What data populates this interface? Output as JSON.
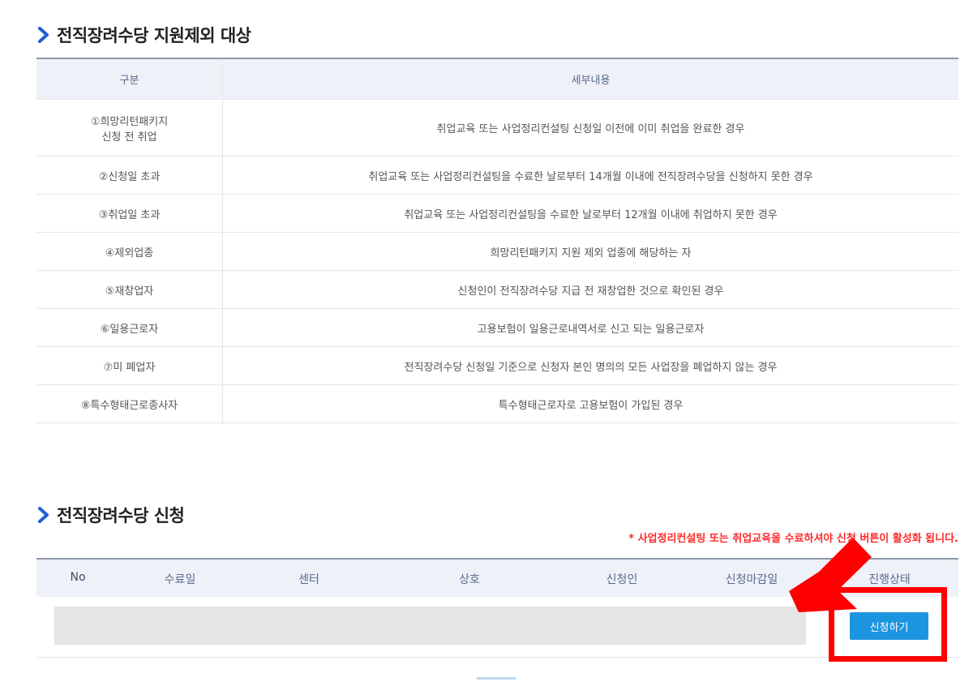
{
  "section1": {
    "title": "전직장려수당 지원제외 대상"
  },
  "exclusion_table": {
    "columns": [
      "구분",
      "세부내용"
    ],
    "rows": [
      {
        "category": "①희망리턴패키지\n신청 전 취업",
        "detail": "취업교육 또는 사업정리컨설팅 신청일 이전에 이미 취업을 완료한 경우"
      },
      {
        "category": "②신청일 초과",
        "detail": "취업교육 또는 사업정리컨설팅을 수료한 날로부터 14개월 이내에 전직장려수당을 신청하지 못한 경우"
      },
      {
        "category": "③취업일 초과",
        "detail": "취업교육 또는 사업정리컨설팅을 수료한 날로부터 12개월 이내에 취업하지 못한 경우"
      },
      {
        "category": "④제외업종",
        "detail": "희망리턴패키지 지원 제외 업종에 해당하는 자"
      },
      {
        "category": "⑤재창업자",
        "detail": "신청인이 전직장려수당 지급 전 재창업한 것으로 확인된 경우"
      },
      {
        "category": "⑥일용근로자",
        "detail": "고용보험이 일용근로내역서로 신고 되는 일용근로자"
      },
      {
        "category": "⑦미 폐업자",
        "detail": "전직장려수당 신청일 기준으로 신청자 본인 명의의 모든 사업장을 폐업하지 않는 경우"
      },
      {
        "category": "⑧특수형태근로종사자",
        "detail": "특수형태근로자로 고용보험이 가입된 경우"
      }
    ]
  },
  "section2": {
    "title": "전직장려수당 신청",
    "notice": "* 사업정리컨설팅 또는 취업교육을 수료하셔야 신청 버튼이 활성화 됩니다."
  },
  "apply_table": {
    "columns": [
      "No",
      "수료일",
      "센터",
      "상호",
      "신청인",
      "신청마감일",
      "진행상태"
    ],
    "button_label": "신청하기"
  },
  "colors": {
    "accent_blue": "#1c95e0",
    "chevron": "#1f5fd1",
    "notice_red": "#ff2a2a",
    "highlight_red": "#ff0000"
  },
  "icons": {
    "section_bullet": "chevron-right-icon",
    "annotation": "arrow-down-right-icon"
  }
}
